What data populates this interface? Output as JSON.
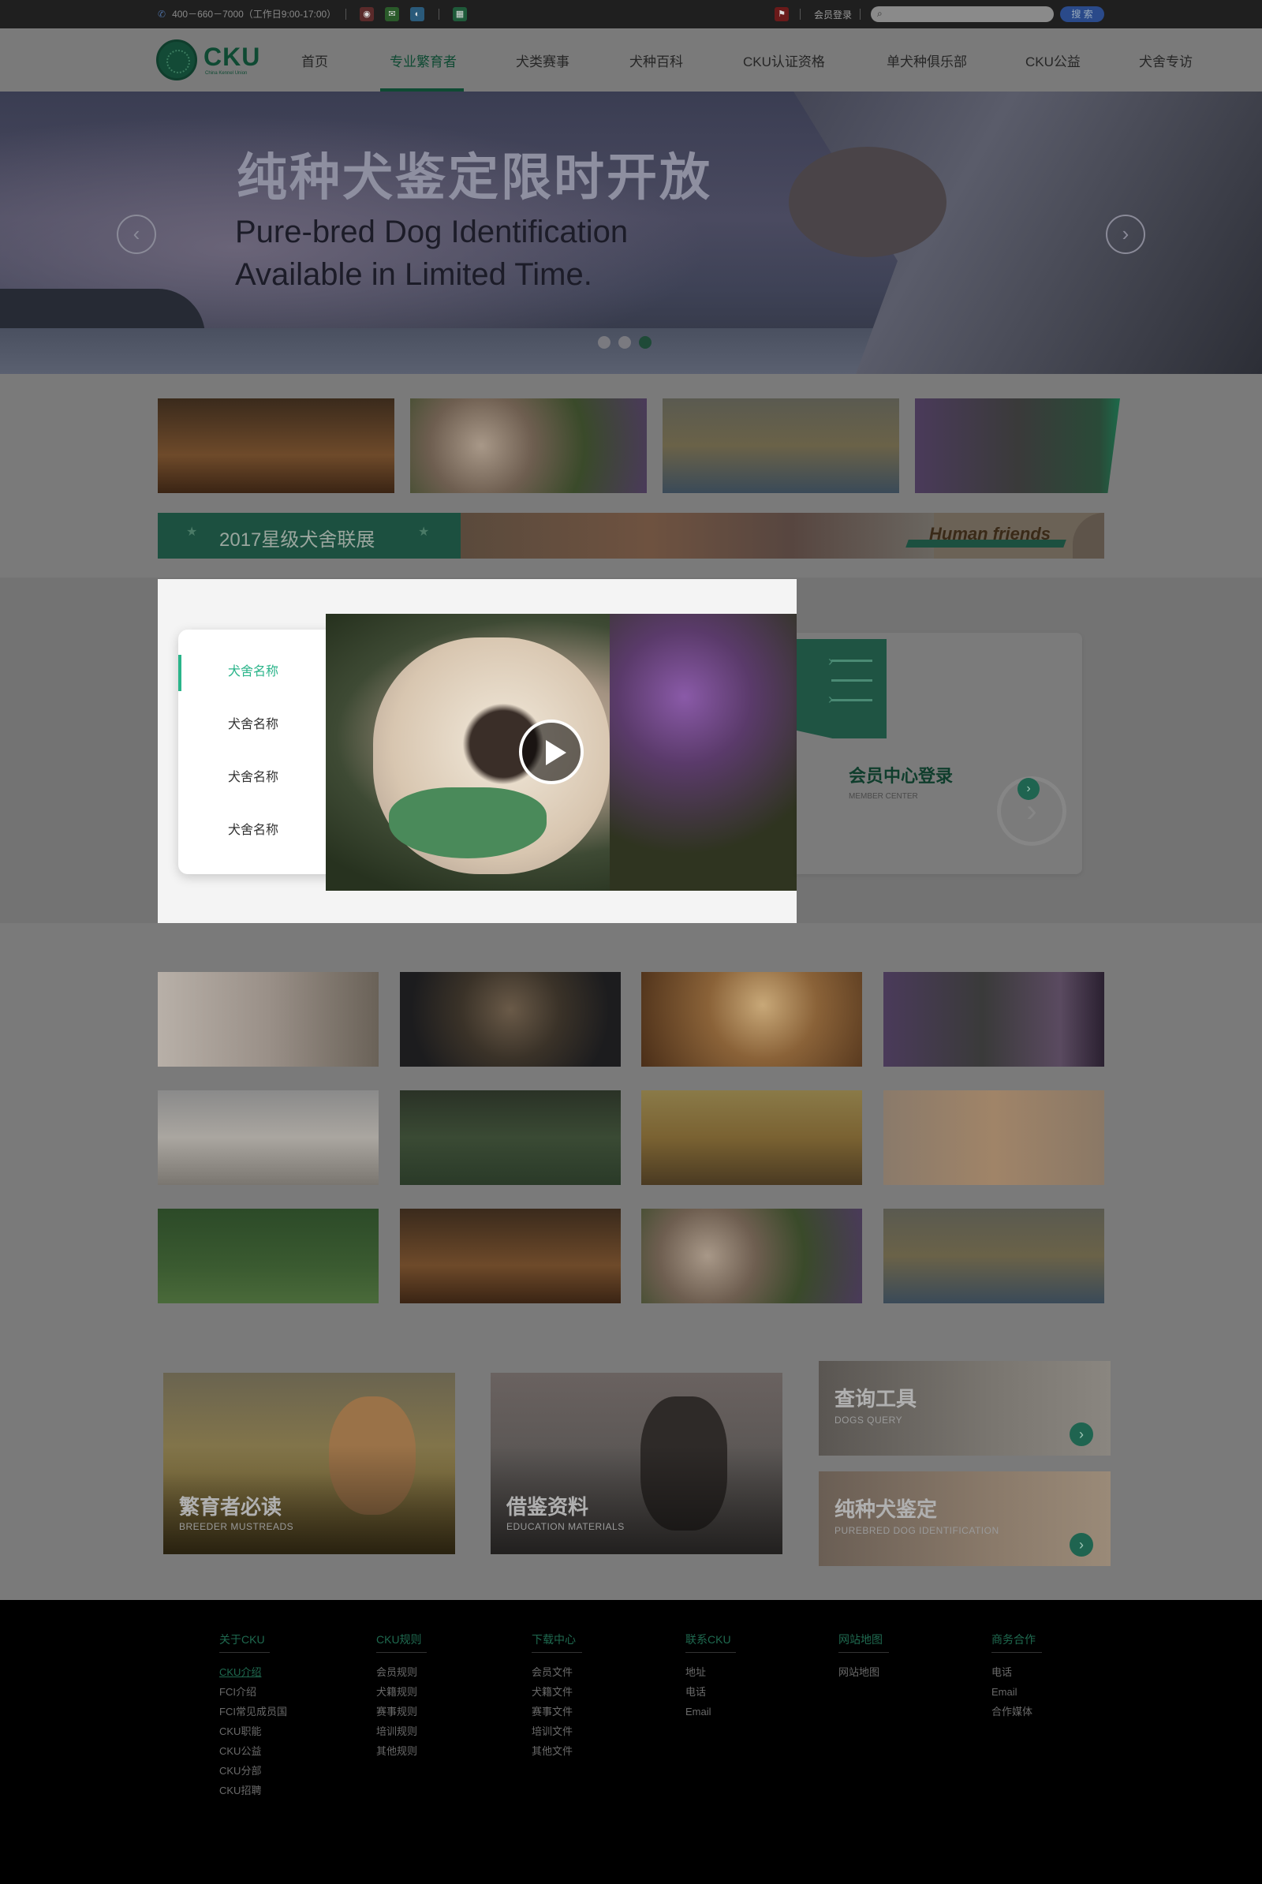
{
  "topbar": {
    "phone": "400－660－7000（工作日9:00-17:00）",
    "member_login": "会员登录",
    "search_placeholder": "",
    "search_button": "搜 索"
  },
  "nav": {
    "brand": "CKU",
    "brand_sub": "China Kennel Union",
    "items": [
      "首页",
      "专业繁育者",
      "犬类赛事",
      "犬种百科",
      "CKU认证资格",
      "单犬种俱乐部",
      "CKU公益",
      "犬舍专访"
    ],
    "active_index": 1
  },
  "banner": {
    "cn_title": "纯种犬鉴定限时开放",
    "en_line1": "Pure-bred Dog Identification",
    "en_line2": "Available in Limited Time.",
    "slide_count": 3,
    "active_slide": 3
  },
  "promo": {
    "title": "2017星级犬舍联展",
    "tagline": "Human friends"
  },
  "kennel_modal": {
    "tabs": [
      "犬舍名称",
      "犬舍名称",
      "犬舍名称",
      "犬舍名称"
    ],
    "active_tab": 0
  },
  "member_center": {
    "title": "会员中心登录",
    "subtitle": "MEMBER CENTER"
  },
  "features": {
    "breeder": {
      "title": "繁育者必读",
      "subtitle": "BREEDER MUSTREADS"
    },
    "education": {
      "title": "借鉴资料",
      "subtitle": "EDUCATION MATERIALS"
    },
    "query": {
      "title": "查询工具",
      "subtitle": "DOGS QUERY"
    },
    "identification": {
      "title": "纯种犬鉴定",
      "subtitle": "PUREBRED DOG IDENTIFICATION"
    }
  },
  "footer": {
    "columns": [
      {
        "heading": "关于CKU",
        "links": [
          "CKU介绍",
          "FCI介绍",
          "FCI常见成员国",
          "CKU职能",
          "CKU公益",
          "CKU分部",
          "CKU招聘"
        ]
      },
      {
        "heading": "CKU规则",
        "links": [
          "会员规则",
          "犬籍规则",
          "赛事规则",
          "培训规则",
          "其他规则"
        ]
      },
      {
        "heading": "下载中心",
        "links": [
          "会员文件",
          "犬籍文件",
          "赛事文件",
          "培训文件",
          "其他文件"
        ]
      },
      {
        "heading": "联系CKU",
        "links": [
          "地址",
          "电话",
          "Email"
        ]
      },
      {
        "heading": "网站地图",
        "links": [
          "网站地图"
        ]
      },
      {
        "heading": "商务合作",
        "links": [
          "电话",
          "Email",
          "合作媒体"
        ]
      }
    ]
  },
  "colors": {
    "brand_green": "#2ab48a",
    "dark_green": "#0f4a33",
    "overlay_gray": "#7a7a7a",
    "footer_bg": "#000000"
  },
  "icons": [
    "phone-icon",
    "weibo-icon",
    "wechat-icon",
    "qq-icon",
    "app-icon",
    "flag-icon",
    "search-icon",
    "play-icon",
    "chevron-left-icon",
    "chevron-right-icon",
    "arrow-right-icon"
  ]
}
